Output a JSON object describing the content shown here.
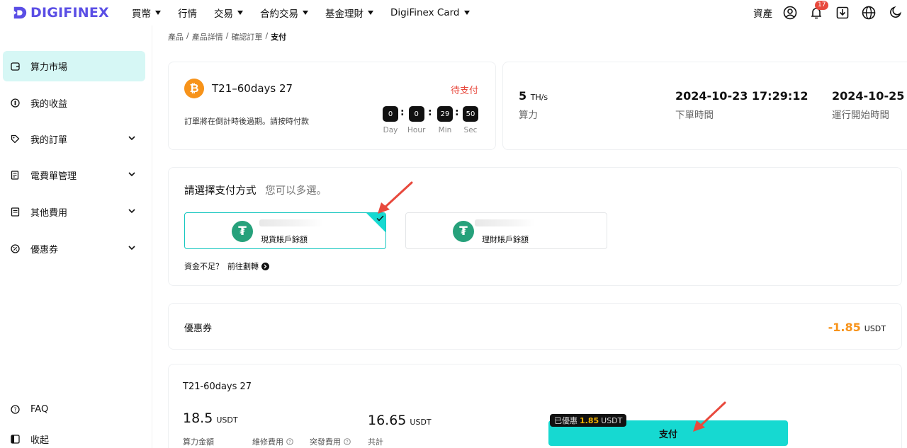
{
  "brand": {
    "name": "DIGIFINEX",
    "color": "#5a4ee5"
  },
  "nav": {
    "items": [
      {
        "label": "買幣",
        "dropdown": true
      },
      {
        "label": "行情",
        "dropdown": false
      },
      {
        "label": "交易",
        "dropdown": true
      },
      {
        "label": "合約交易",
        "dropdown": true
      },
      {
        "label": "基金理財",
        "dropdown": true
      },
      {
        "label": "DigiFinex Card",
        "dropdown": true
      }
    ],
    "asset_label": "資產",
    "notification_count": "17"
  },
  "sidebar": {
    "items": [
      {
        "label": "算力市場",
        "icon": "wallet-icon",
        "active": true,
        "expandable": false
      },
      {
        "label": "我的收益",
        "icon": "coin-icon",
        "active": false,
        "expandable": false
      },
      {
        "label": "我的訂單",
        "icon": "tag-icon",
        "active": false,
        "expandable": true
      },
      {
        "label": "電費單管理",
        "icon": "bill-icon",
        "active": false,
        "expandable": true
      },
      {
        "label": "其他費用",
        "icon": "document-icon",
        "active": false,
        "expandable": true
      },
      {
        "label": "優惠券",
        "icon": "coupon-icon",
        "active": false,
        "expandable": true
      }
    ],
    "faq_label": "FAQ",
    "collapse_label": "收起"
  },
  "breadcrumb": [
    "產品",
    "產品詳情",
    "確認訂單",
    "支付"
  ],
  "order": {
    "product_name": "T21–60days 27",
    "status": "待支付",
    "status_color": "#e8493d",
    "expire_note": "訂單將在倒計時後過期。請按時付款",
    "countdown": {
      "day": "0",
      "hour": "0",
      "min": "29",
      "sec": "50",
      "labels": {
        "day": "Day",
        "hour": "Hour",
        "min": "Min",
        "sec": "Sec"
      }
    }
  },
  "summary": {
    "hashrate_value": "5",
    "hashrate_unit": "TH/s",
    "hashrate_label": "算力",
    "order_time": "2024-10-23 17:29:12",
    "order_time_label": "下單時間",
    "start_time": "2024-10-25",
    "start_time_label": "運行開始時間"
  },
  "payment": {
    "title": "請選擇支付方式",
    "hint": "您可以多選。",
    "options": [
      {
        "label": "現貨賬戶餘額",
        "selected": true
      },
      {
        "label": "理財賬戶餘額",
        "selected": false
      }
    ],
    "insufficient_text": "資金不足？",
    "transfer_link": "前往劃轉"
  },
  "coupon": {
    "label": "優惠券",
    "amount": "-1.85",
    "unit": "USDT",
    "color": "#f7931a"
  },
  "checkout": {
    "product_name": "T21-60days 27",
    "amount": "18.5",
    "amount_unit": "USDT",
    "total": "16.65",
    "total_unit": "USDT",
    "labels": {
      "amount": "算力金額",
      "maintenance": "維修費用",
      "emergency": "突發費用",
      "total": "共計"
    },
    "discount_prefix": "已優惠",
    "discount_value": "1.85",
    "discount_unit": "USDT",
    "pay_button": "支付",
    "button_color": "#16d9d1"
  }
}
